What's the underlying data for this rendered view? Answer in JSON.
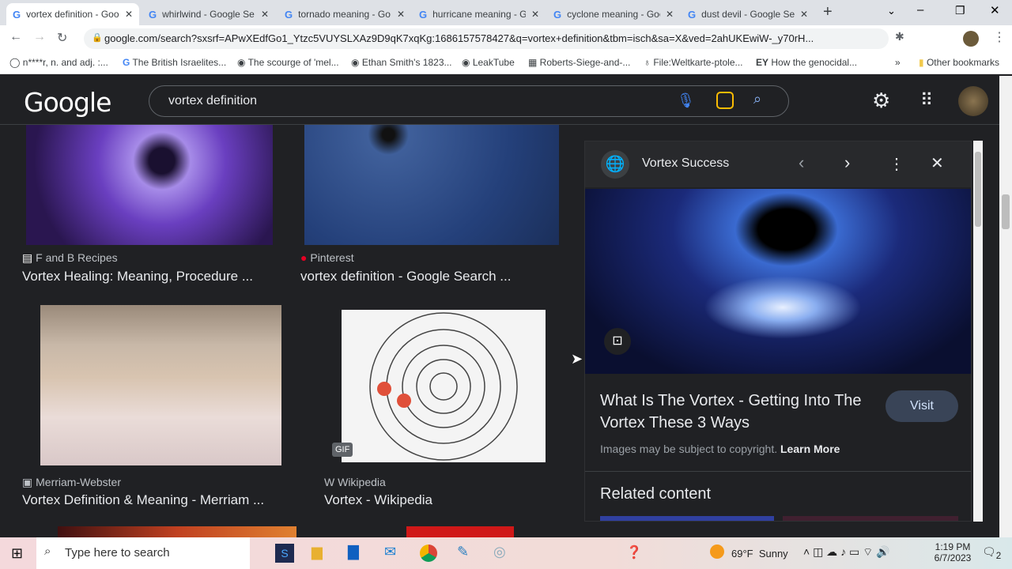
{
  "tabs": [
    {
      "label": "vortex definition - Goo",
      "active": true
    },
    {
      "label": "whirlwind - Google Se"
    },
    {
      "label": "tornado meaning - Go"
    },
    {
      "label": "hurricane meaning - G"
    },
    {
      "label": "cyclone meaning - Goo"
    },
    {
      "label": "dust devil - Google Se"
    }
  ],
  "address": {
    "url": "google.com/search?sxsrf=APwXEdfGo1_Ytzc5VUYSLXAz9D9qK7xqKg:1686157578427&q=vortex+definition&tbm=isch&sa=X&ved=2ahUKEwiW-_y70rH..."
  },
  "bookmarks": [
    "n****r, n. and adj. :...",
    "The British Israelites...",
    "The scourge of 'mel...",
    "Ethan Smith's 1823...",
    "LeakTube",
    "Roberts-Siege-and-...",
    "File:Weltkarte-ptole...",
    "How the genocidal..."
  ],
  "bookmarks_other": "Other bookmarks",
  "header": {
    "logo": "Google",
    "query": "vortex definition"
  },
  "results": [
    {
      "source": "F and B Recipes",
      "title": "Vortex Healing: Meaning, Procedure ..."
    },
    {
      "source": "Pinterest",
      "title": "vortex definition - Google Search ..."
    },
    {
      "source": "Merriam-Webster",
      "title": "Vortex Definition & Meaning - Merriam ..."
    },
    {
      "source": "Wikipedia",
      "title": "Vortex - Wikipedia"
    }
  ],
  "gif_badge": "GIF",
  "panel": {
    "site": "Vortex Success",
    "title": "What Is The Vortex - Getting Into The Vortex These 3 Ways",
    "visit": "Visit",
    "copyright": "Images may be subject to copyright.",
    "learn_more": "Learn More",
    "related": "Related content"
  },
  "taskbar": {
    "search_placeholder": "Type here to search",
    "weather": "69°F  Sunny",
    "time": "1:19 PM",
    "date": "6/7/2023",
    "notifications": "2"
  }
}
